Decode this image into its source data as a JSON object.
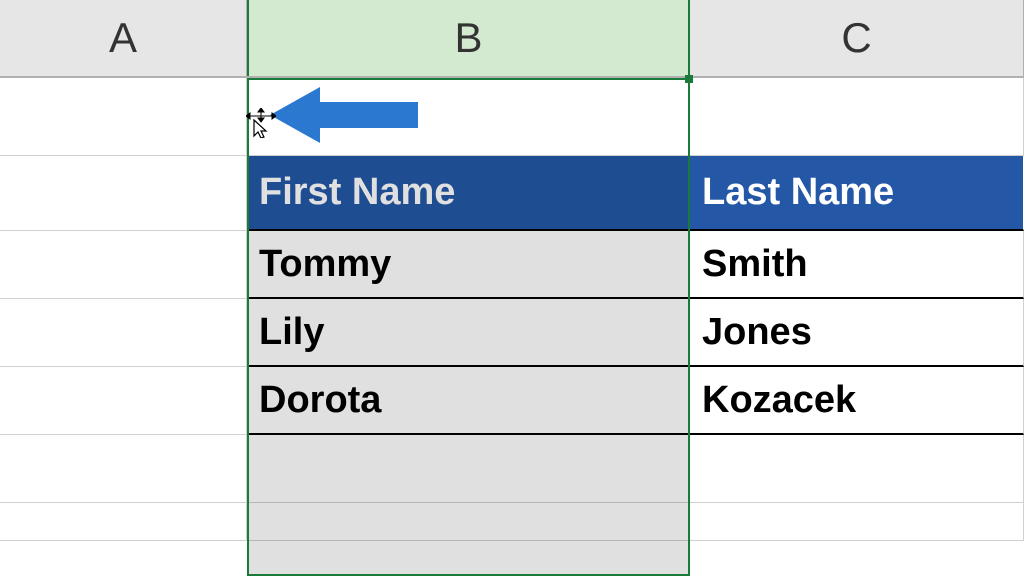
{
  "columns": {
    "a": "A",
    "b": "B",
    "c": "C"
  },
  "table": {
    "headers": {
      "first": "First Name",
      "last": "Last Name"
    },
    "rows": [
      {
        "first": "Tommy",
        "last": "Smith"
      },
      {
        "first": "Lily",
        "last": "Jones"
      },
      {
        "first": "Dorota",
        "last": "Kozacek"
      }
    ]
  },
  "selected_column": "B",
  "colors": {
    "header_bg": "#2458a6",
    "selection_border": "#1a7a3a",
    "arrow": "#2a78d0"
  },
  "chart_data": {
    "type": "table",
    "title": "",
    "columns": [
      "First Name",
      "Last Name"
    ],
    "rows": [
      [
        "Tommy",
        "Smith"
      ],
      [
        "Lily",
        "Jones"
      ],
      [
        "Dorota",
        "Kozacek"
      ]
    ]
  }
}
